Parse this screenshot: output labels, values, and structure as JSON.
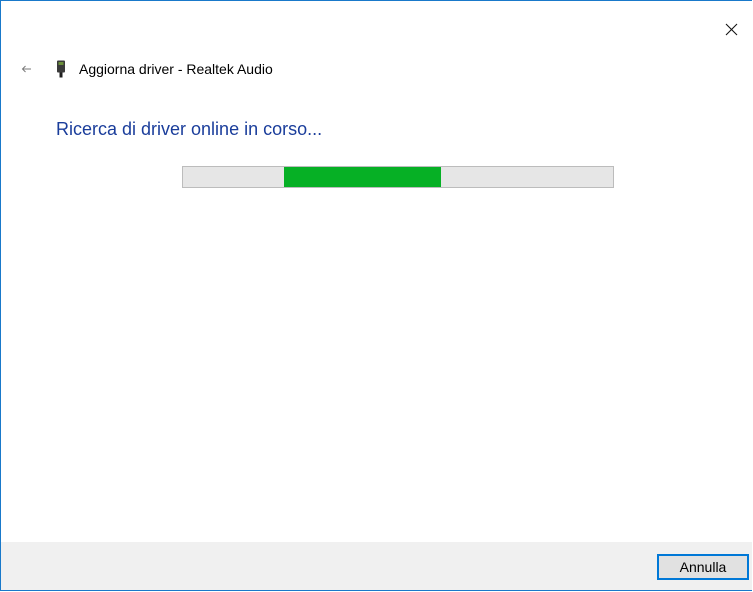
{
  "window": {
    "title": "Aggiorna driver - Realtek Audio"
  },
  "icons": {
    "back": "back-arrow-icon",
    "close": "close-icon",
    "device": "audio-device-icon"
  },
  "main": {
    "heading": "Ricerca di driver online in corso...",
    "progress": {
      "indeterminate": true,
      "fill_start_fraction": 0.236,
      "fill_end_fraction": 0.6
    }
  },
  "footer": {
    "cancel_label": "Annulla"
  },
  "colors": {
    "heading": "#1a3d9b",
    "progress_fill": "#06b025",
    "progress_track": "#e6e6e6",
    "window_border": "#1979ca",
    "footer_bg": "#f0f0f0",
    "button_border": "#0078d7"
  }
}
